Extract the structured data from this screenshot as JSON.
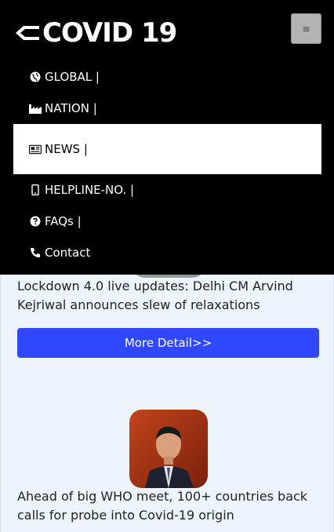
{
  "brand": {
    "title": "COVID 19"
  },
  "nav": {
    "items": [
      {
        "label": "GLOBAL |",
        "icon": "globe-icon"
      },
      {
        "label": "NATION |",
        "icon": "industry-icon"
      },
      {
        "label": "NEWS |",
        "icon": "newspaper-icon",
        "active": true
      },
      {
        "label": "HELPLINE-NO. |",
        "icon": "mobile-icon"
      },
      {
        "label": "FAQs |",
        "icon": "question-circle-icon"
      },
      {
        "label": "Contact",
        "icon": "phone-icon"
      }
    ]
  },
  "news": [
    {
      "headline": "Lockdown 4.0 live updates: Delhi CM Arvind Kejriwal announces slew of relaxations",
      "button": "More Detail>>"
    },
    {
      "headline": "Ahead of big WHO meet, 100+ countries back calls for probe into Covid-19 origin"
    }
  ],
  "colors": {
    "accent": "#3048ff",
    "nav_bg": "#000000",
    "page_bg": "#eef4fc"
  }
}
